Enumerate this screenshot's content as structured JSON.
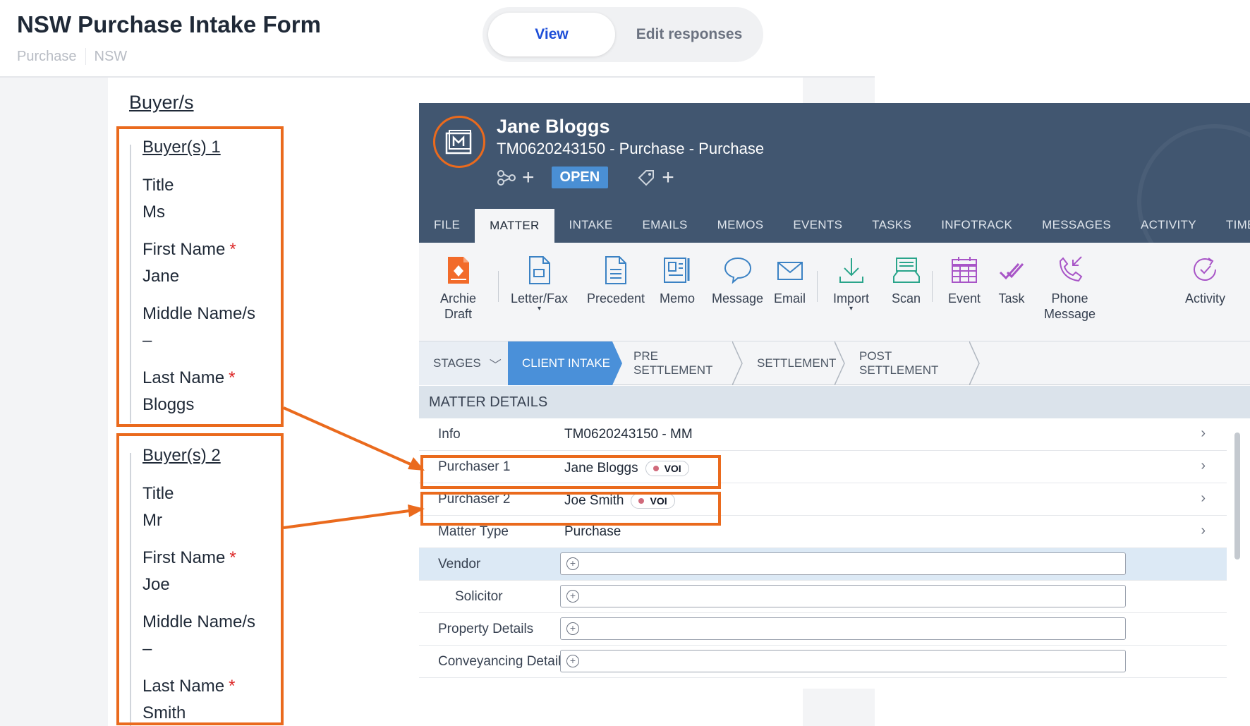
{
  "form": {
    "title": "NSW Purchase Intake Form",
    "breadcrumb": [
      "Purchase",
      "NSW"
    ],
    "toggle": {
      "view": "View",
      "edit": "Edit responses"
    },
    "section_title": "Buyer/s",
    "buyers": [
      {
        "heading": "Buyer(s) 1",
        "title_label": "Title",
        "title": "Ms",
        "first_label": "First Name",
        "first": "Jane",
        "middle_label": "Middle Name/s",
        "middle": "–",
        "last_label": "Last Name",
        "last": "Bloggs",
        "required_mark": "*"
      },
      {
        "heading": "Buyer(s) 2",
        "title_label": "Title",
        "title": "Mr",
        "first_label": "First Name",
        "first": "Joe",
        "middle_label": "Middle Name/s",
        "middle": "–",
        "last_label": "Last Name",
        "last": "Smith",
        "required_mark": "*"
      }
    ]
  },
  "matter": {
    "name": "Jane Bloggs",
    "subtitle": "TM0620243150 - Purchase - Purchase",
    "status": "OPEN",
    "tabs": [
      "FILE",
      "MATTER",
      "INTAKE",
      "EMAILS",
      "MEMOS",
      "EVENTS",
      "TASKS",
      "INFOTRACK",
      "MESSAGES",
      "ACTIVITY",
      "TIME & DI"
    ],
    "active_tab": "MATTER",
    "ribbon": [
      {
        "label": "Archie\nDraft",
        "icon": "archie-draft-icon"
      },
      {
        "label": "Letter/Fax",
        "icon": "letter-icon"
      },
      {
        "label": "Precedent",
        "icon": "precedent-icon"
      },
      {
        "label": "Memo",
        "icon": "memo-icon"
      },
      {
        "label": "Message",
        "icon": "message-icon"
      },
      {
        "label": "Email",
        "icon": "email-icon"
      },
      {
        "label": "Import",
        "icon": "import-icon"
      },
      {
        "label": "Scan",
        "icon": "scan-icon"
      },
      {
        "label": "Event",
        "icon": "calendar-icon"
      },
      {
        "label": "Task",
        "icon": "task-icon"
      },
      {
        "label": "Phone\nMessage",
        "icon": "phone-icon"
      },
      {
        "label": "Activity",
        "icon": "activity-icon"
      }
    ],
    "stages": [
      "STAGES",
      "CLIENT INTAKE",
      "PRE SETTLEMENT",
      "SETTLEMENT",
      "POST SETTLEMENT"
    ],
    "details_header": "MATTER DETAILS",
    "rows": {
      "info": {
        "label": "Info",
        "value": "TM0620243150 - MM"
      },
      "purchaser1": {
        "label": "Purchaser 1",
        "value": "Jane Bloggs",
        "badge": "VOI"
      },
      "purchaser2": {
        "label": "Purchaser 2",
        "value": "Joe Smith",
        "badge": "VOI"
      },
      "matter_type": {
        "label": "Matter Type",
        "value": "Purchase"
      },
      "vendor": {
        "label": "Vendor"
      },
      "solicitor": {
        "label": "Solicitor"
      },
      "property": {
        "label": "Property Details"
      },
      "conveyancing": {
        "label": "Conveyancing Details"
      }
    }
  },
  "colors": {
    "highlight": "#ea6a1d",
    "header": "#415670",
    "stage_active": "#4a90d9",
    "link": "#1d4ed8"
  }
}
